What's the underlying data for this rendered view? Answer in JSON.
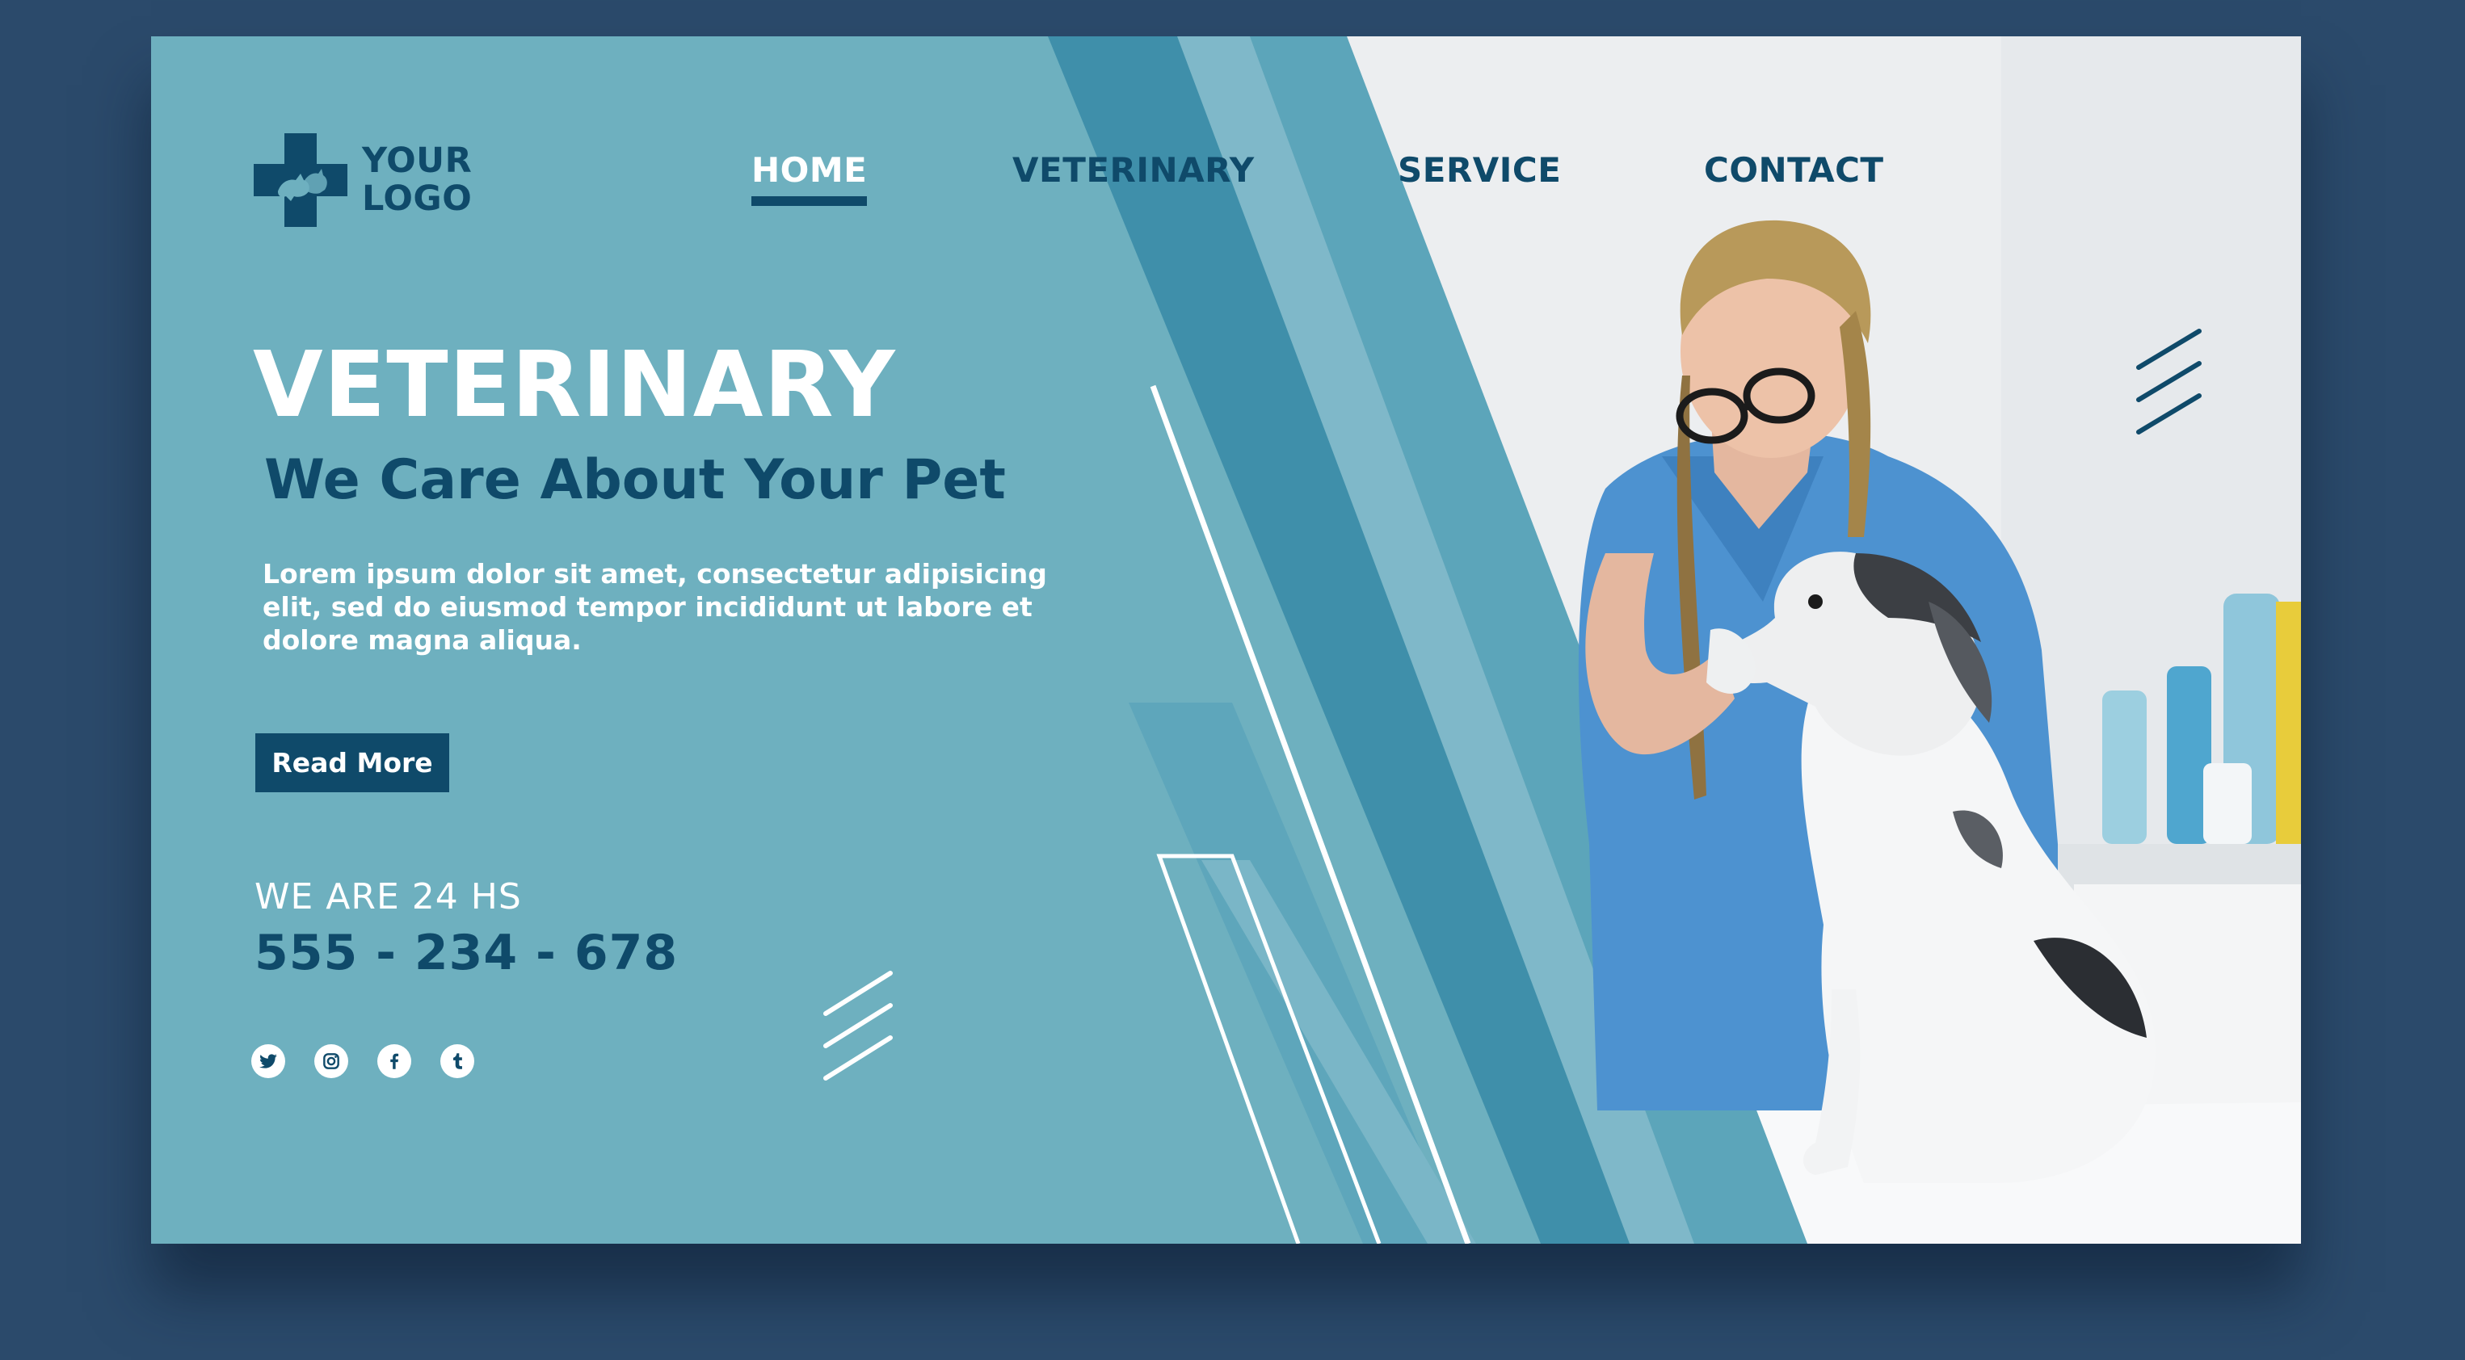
{
  "logo": {
    "line1": "YOUR",
    "line2": "LOGO",
    "icon": "cross-pet-icon"
  },
  "nav": {
    "items": [
      {
        "label": "HOME",
        "active": true
      },
      {
        "label": "VETERINARY",
        "active": false
      },
      {
        "label": "SERVICE",
        "active": false
      },
      {
        "label": "CONTACT",
        "active": false
      }
    ]
  },
  "hero": {
    "title": "VETERINARY",
    "subtitle": "We Care About Your Pet",
    "body": "Lorem ipsum dolor sit amet, consectetur adipisicing elit, sed do eiusmod tempor incididunt ut labore et dolore magna aliqua.",
    "cta_label": "Read More"
  },
  "contact": {
    "hours_label": "WE ARE 24 HS",
    "phone": "555 - 234 - 678"
  },
  "social": [
    {
      "name": "twitter-icon"
    },
    {
      "name": "instagram-icon"
    },
    {
      "name": "facebook-icon"
    },
    {
      "name": "tumblr-icon"
    }
  ],
  "colors": {
    "page_background": "#2b4a6b",
    "panel": "#6eb0bf",
    "stripe_dark": "#3f8faa",
    "stripe_light": "#7fb8c9",
    "navy": "#0f4a6a",
    "white": "#ffffff"
  }
}
